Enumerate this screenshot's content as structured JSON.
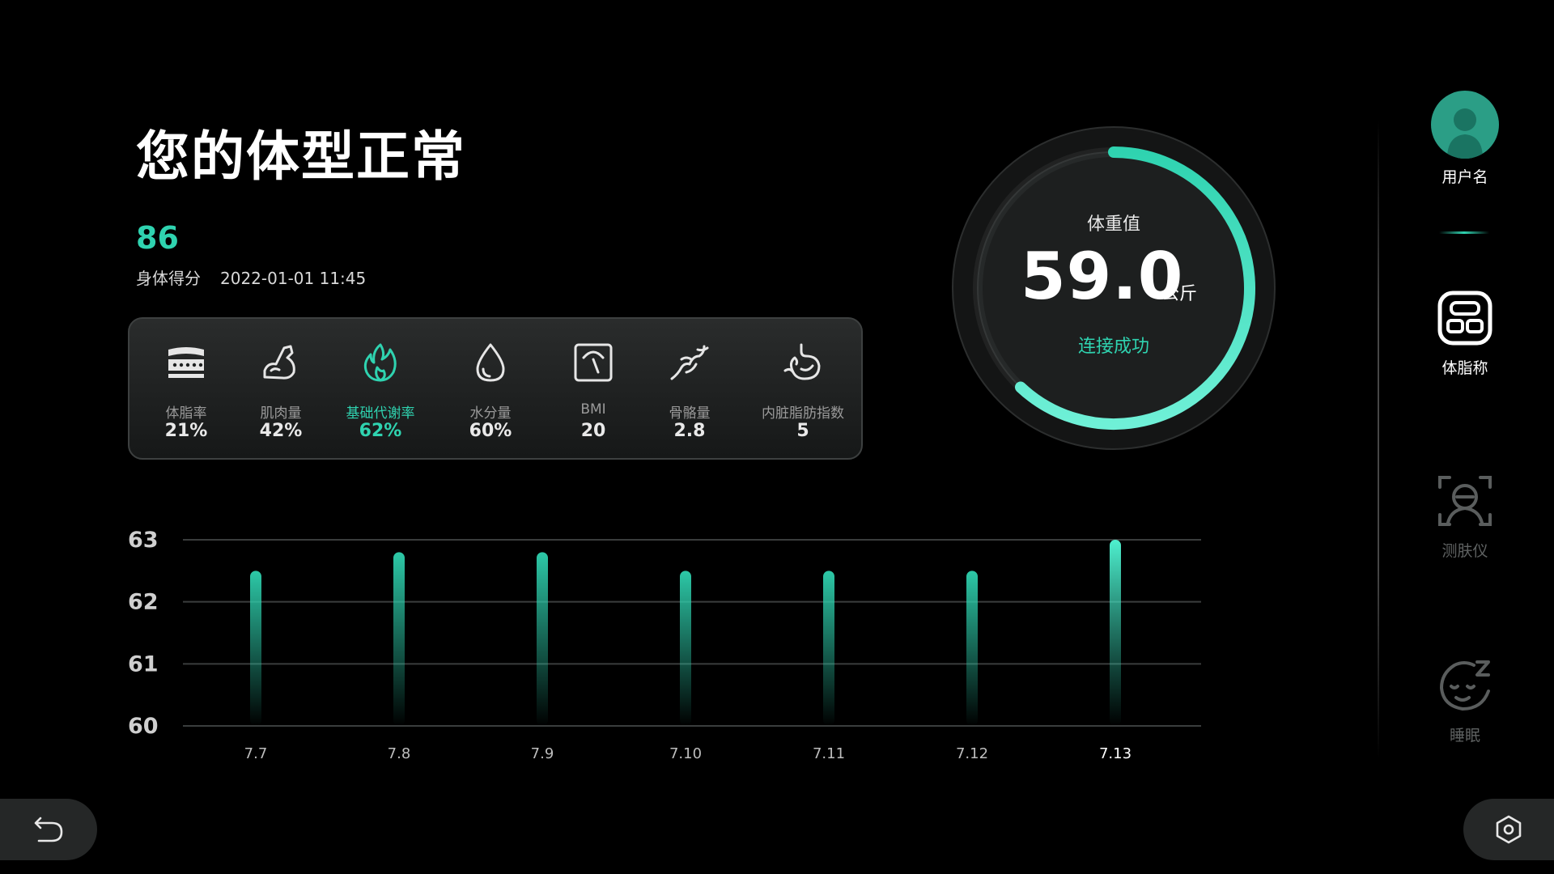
{
  "header": {
    "title": "您的体型正常",
    "score": "86",
    "score_label": "身体得分",
    "timestamp": "2022-01-01  11:45"
  },
  "metrics": [
    {
      "label": "体脂率",
      "value": "21%",
      "icon": "body-fat-icon"
    },
    {
      "label": "肌肉量",
      "value": "42%",
      "icon": "muscle-arm-icon"
    },
    {
      "label": "基础代谢率",
      "value": "62%",
      "icon": "flame-icon",
      "active": true
    },
    {
      "label": "水分量",
      "value": "60%",
      "icon": "water-drop-icon"
    },
    {
      "label": "BMI",
      "value": "20",
      "icon": "scale-gauge-icon"
    },
    {
      "label": "骨骼量",
      "value": "2.8",
      "icon": "bone-joint-icon"
    },
    {
      "label": "内脏脂肪指数",
      "value": "5",
      "icon": "stomach-icon"
    }
  ],
  "gauge": {
    "label": "体重值",
    "value": "59.0",
    "unit": "公斤",
    "status": "连接成功",
    "progress": 0.62
  },
  "chart_data": {
    "type": "bar",
    "categories": [
      "7.7",
      "7.8",
      "7.9",
      "7.10",
      "7.11",
      "7.12",
      "7.13"
    ],
    "values": [
      62.5,
      62.8,
      62.8,
      62.5,
      62.5,
      62.5,
      63.0
    ],
    "yticks": [
      63,
      62,
      61,
      60
    ],
    "ylim": [
      60,
      63
    ],
    "highlight_index": 6,
    "grid": true
  },
  "sidebar": {
    "items": [
      {
        "label": "用户名",
        "icon": "user-avatar-icon",
        "active": true
      },
      {
        "label": "体脂称",
        "icon": "body-scale-icon"
      },
      {
        "label": "测肤仪",
        "icon": "skin-tester-icon"
      },
      {
        "label": "睡眠",
        "icon": "sleep-face-icon"
      }
    ]
  },
  "controls": {
    "back_icon": "back-arrow-icon",
    "settings_icon": "settings-hex-icon"
  },
  "colors": {
    "accent": "#2fd3b0",
    "background": "#000000",
    "panel": "#1f2121",
    "muted": "#9a9a9a"
  }
}
